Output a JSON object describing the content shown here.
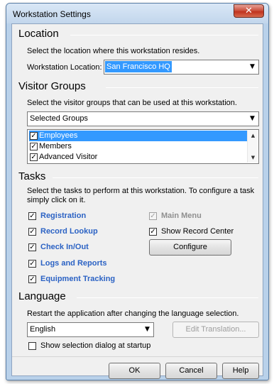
{
  "window": {
    "title": "Workstation Settings",
    "close_glyph": "✕"
  },
  "location": {
    "heading": "Location",
    "description": "Select the location where this workstation resides.",
    "field_label": "Workstation Location:",
    "value": "San Francisco HQ"
  },
  "visitor_groups": {
    "heading": "Visitor Groups",
    "description": "Select the visitor groups that can be used at this workstation.",
    "selection_mode": "Selected Groups",
    "items": [
      {
        "label": "Employees",
        "checked": true,
        "selected": true
      },
      {
        "label": "Members",
        "checked": true,
        "selected": false
      },
      {
        "label": "Advanced Visitor",
        "checked": true,
        "selected": false
      }
    ]
  },
  "tasks": {
    "heading": "Tasks",
    "description_line1": "Select the tasks to perform at this workstation. To configure a task",
    "description_line2": "simply click on it.",
    "left": [
      {
        "label": "Registration",
        "checked": true
      },
      {
        "label": "Record Lookup",
        "checked": true
      },
      {
        "label": "Check In/Out",
        "checked": true
      },
      {
        "label": "Logs and Reports",
        "checked": true
      },
      {
        "label": "Equipment Tracking",
        "checked": true
      }
    ],
    "main_menu": {
      "label": "Main Menu",
      "checked": true,
      "disabled": true
    },
    "show_record_center": {
      "label": "Show Record Center",
      "checked": true
    },
    "configure_label": "Configure"
  },
  "language": {
    "heading": "Language",
    "description": "Restart the application after changing the language selection.",
    "value": "English",
    "edit_translation_label": "Edit Translation...",
    "show_dialog_label": "Show selection dialog at startup",
    "show_dialog_checked": false
  },
  "buttons": {
    "ok": "OK",
    "cancel": "Cancel",
    "help": "Help"
  },
  "glyphs": {
    "check": "✓",
    "dropdown": "▼",
    "scroll_up": "▲",
    "scroll_down": "▼"
  },
  "colors": {
    "selection": "#3399ff",
    "link": "#2b62c4",
    "frame": "#b9d1ea"
  }
}
